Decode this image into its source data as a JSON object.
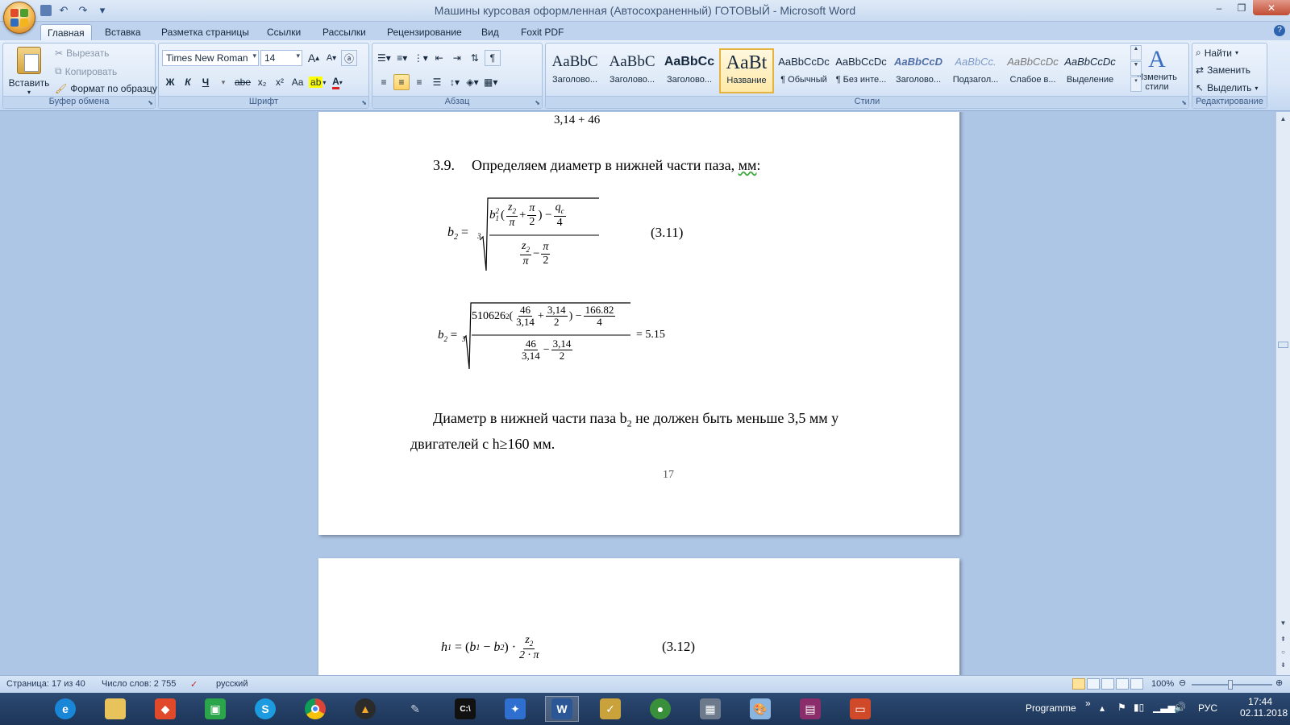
{
  "window": {
    "title": "Машины курсовая оформленная (Автосохраненный) ГОТОВЫЙ - Microsoft Word",
    "controls": {
      "minimize": "–",
      "restore": "❐",
      "close": "✕"
    }
  },
  "quick_access": {
    "undo": "↶",
    "redo": "↷",
    "more": "▾"
  },
  "tabs": [
    "Главная",
    "Вставка",
    "Разметка страницы",
    "Ссылки",
    "Рассылки",
    "Рецензирование",
    "Вид",
    "Foxit PDF"
  ],
  "ribbon": {
    "clipboard": {
      "label": "Буфер обмена",
      "paste": "Вставить",
      "cut": "Вырезать",
      "copy": "Копировать",
      "format_painter": "Формат по образцу"
    },
    "font": {
      "label": "Шрифт",
      "font_name": "Times New Roman",
      "font_size": "14",
      "bold": "Ж",
      "italic": "К",
      "underline": "Ч",
      "strike": "abe",
      "subscript": "x₂",
      "superscript": "x²",
      "case": "Aa",
      "grow": "A",
      "shrink": "A"
    },
    "paragraph": {
      "label": "Абзац",
      "pilcrow": "¶"
    },
    "styles": {
      "label": "Стили",
      "items": [
        {
          "sample": "AaBbC",
          "name": "Заголово..."
        },
        {
          "sample": "AaBbC",
          "name": "Заголово..."
        },
        {
          "sample": "AaBbCc",
          "name": "Заголово..."
        },
        {
          "sample": "AaBt",
          "name": "Название"
        },
        {
          "sample": "AaBbCcDc",
          "name": "¶ Обычный"
        },
        {
          "sample": "AaBbCcDc",
          "name": "¶ Без инте..."
        },
        {
          "sample": "AaBbCcD",
          "name": "Заголово..."
        },
        {
          "sample": "AaBbCc.",
          "name": "Подзагол..."
        },
        {
          "sample": "AaBbCcDc",
          "name": "Слабое в..."
        },
        {
          "sample": "AaBbCcDc",
          "name": "Выделение"
        }
      ],
      "change_styles": "Изменить стили"
    },
    "editing": {
      "label": "Редактирование",
      "find": "Найти",
      "replace": "Заменить",
      "select": "Выделить"
    }
  },
  "document": {
    "page1": {
      "top_formula": "3,14 + 46",
      "heading_num": "3.9.",
      "heading_text": "Определяем диаметр в нижней части паза, ",
      "heading_unit": "мм",
      "heading_colon": ":",
      "eq311": {
        "lhs": "b",
        "lhs_sub": "2",
        "root_index": "3",
        "b1": "b",
        "b1_sub": "1",
        "b1_sup": "2",
        "z2": "z",
        "z2_sub": "2",
        "pi": "π",
        "two": "2",
        "q": "q",
        "q_sub": "c",
        "four": "4",
        "number": "(3.11)"
      },
      "eq_num": {
        "coef": "510626",
        "coef_sup": "2",
        "n46": "46",
        "d314": "3,14",
        "n314": "3,14",
        "d2": "2",
        "n16682": "166.82",
        "d4": "4",
        "result": "= 5.15"
      },
      "para_line1": "Диаметр в нижней части паза b",
      "para_sub": "2",
      "para_line1b": " не должен быть меньше 3,5 мм у",
      "para_line2": "двигателей с h≥160 мм.",
      "page_number": "17"
    },
    "page2": {
      "eq312": {
        "lhs": "h",
        "lhs_sub": "1",
        "b1": "b",
        "b1_sub": "1",
        "b2": "b",
        "b2_sub": "2",
        "z2": "z",
        "z2_sub": "2",
        "den": "2 · π",
        "number": "(3.12)"
      }
    }
  },
  "status_bar": {
    "page": "Страница: 17 из 40",
    "words": "Число слов: 2 755",
    "language": "русский",
    "zoom": "100%"
  },
  "taskbar": {
    "programme": "Programme",
    "language": "РУС",
    "time": "17:44",
    "date": "02.11.2018"
  },
  "colors": {
    "ribbon_bg": "#d9e6f7",
    "doc_bg": "#aec6e6",
    "taskbar_bg": "#1d3558",
    "selected_style": "#ffe9a8"
  }
}
